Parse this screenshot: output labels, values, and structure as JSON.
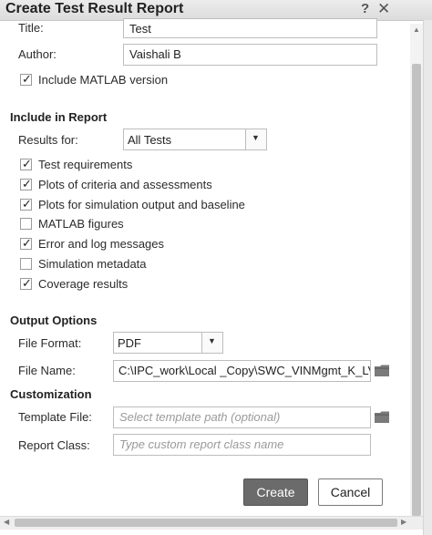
{
  "window": {
    "title": "Create Test Result Report",
    "help_label": "?",
    "close_label": "✕"
  },
  "details": {
    "title_label": "Title:",
    "title_value": "Test",
    "author_label": "Author:",
    "author_value": "Vaishali B",
    "include_matlab_version": {
      "label": "Include MATLAB version",
      "checked": true
    }
  },
  "include_in_report": {
    "heading": "Include in Report",
    "results_for_label": "Results for:",
    "results_for_value": "All Tests",
    "options": [
      {
        "label": "Test requirements",
        "checked": true
      },
      {
        "label": "Plots of criteria and assessments",
        "checked": true
      },
      {
        "label": "Plots for simulation output and baseline",
        "checked": true
      },
      {
        "label": "MATLAB figures",
        "checked": false
      },
      {
        "label": "Error and log messages",
        "checked": true
      },
      {
        "label": "Simulation metadata",
        "checked": false
      },
      {
        "label": "Coverage results",
        "checked": true
      }
    ]
  },
  "output_options": {
    "heading": "Output Options",
    "file_format_label": "File Format:",
    "file_format_value": "PDF",
    "file_name_label": "File Name:",
    "file_name_value": "C:\\IPC_work\\Local _Copy\\SWC_VINMgmt_K_LV"
  },
  "customization": {
    "heading": "Customization",
    "template_file_label": "Template File:",
    "template_file_placeholder": "Select template path (optional)",
    "report_class_label": "Report Class:",
    "report_class_placeholder": "Type custom report class name"
  },
  "buttons": {
    "create": "Create",
    "cancel": "Cancel"
  },
  "icons": {
    "folder": "folder-icon",
    "dropdown": "chevron-down-icon",
    "checkmark": "✓"
  },
  "colors": {
    "primary_button": "#6b6b6b",
    "folder": "#7a7a7a"
  }
}
